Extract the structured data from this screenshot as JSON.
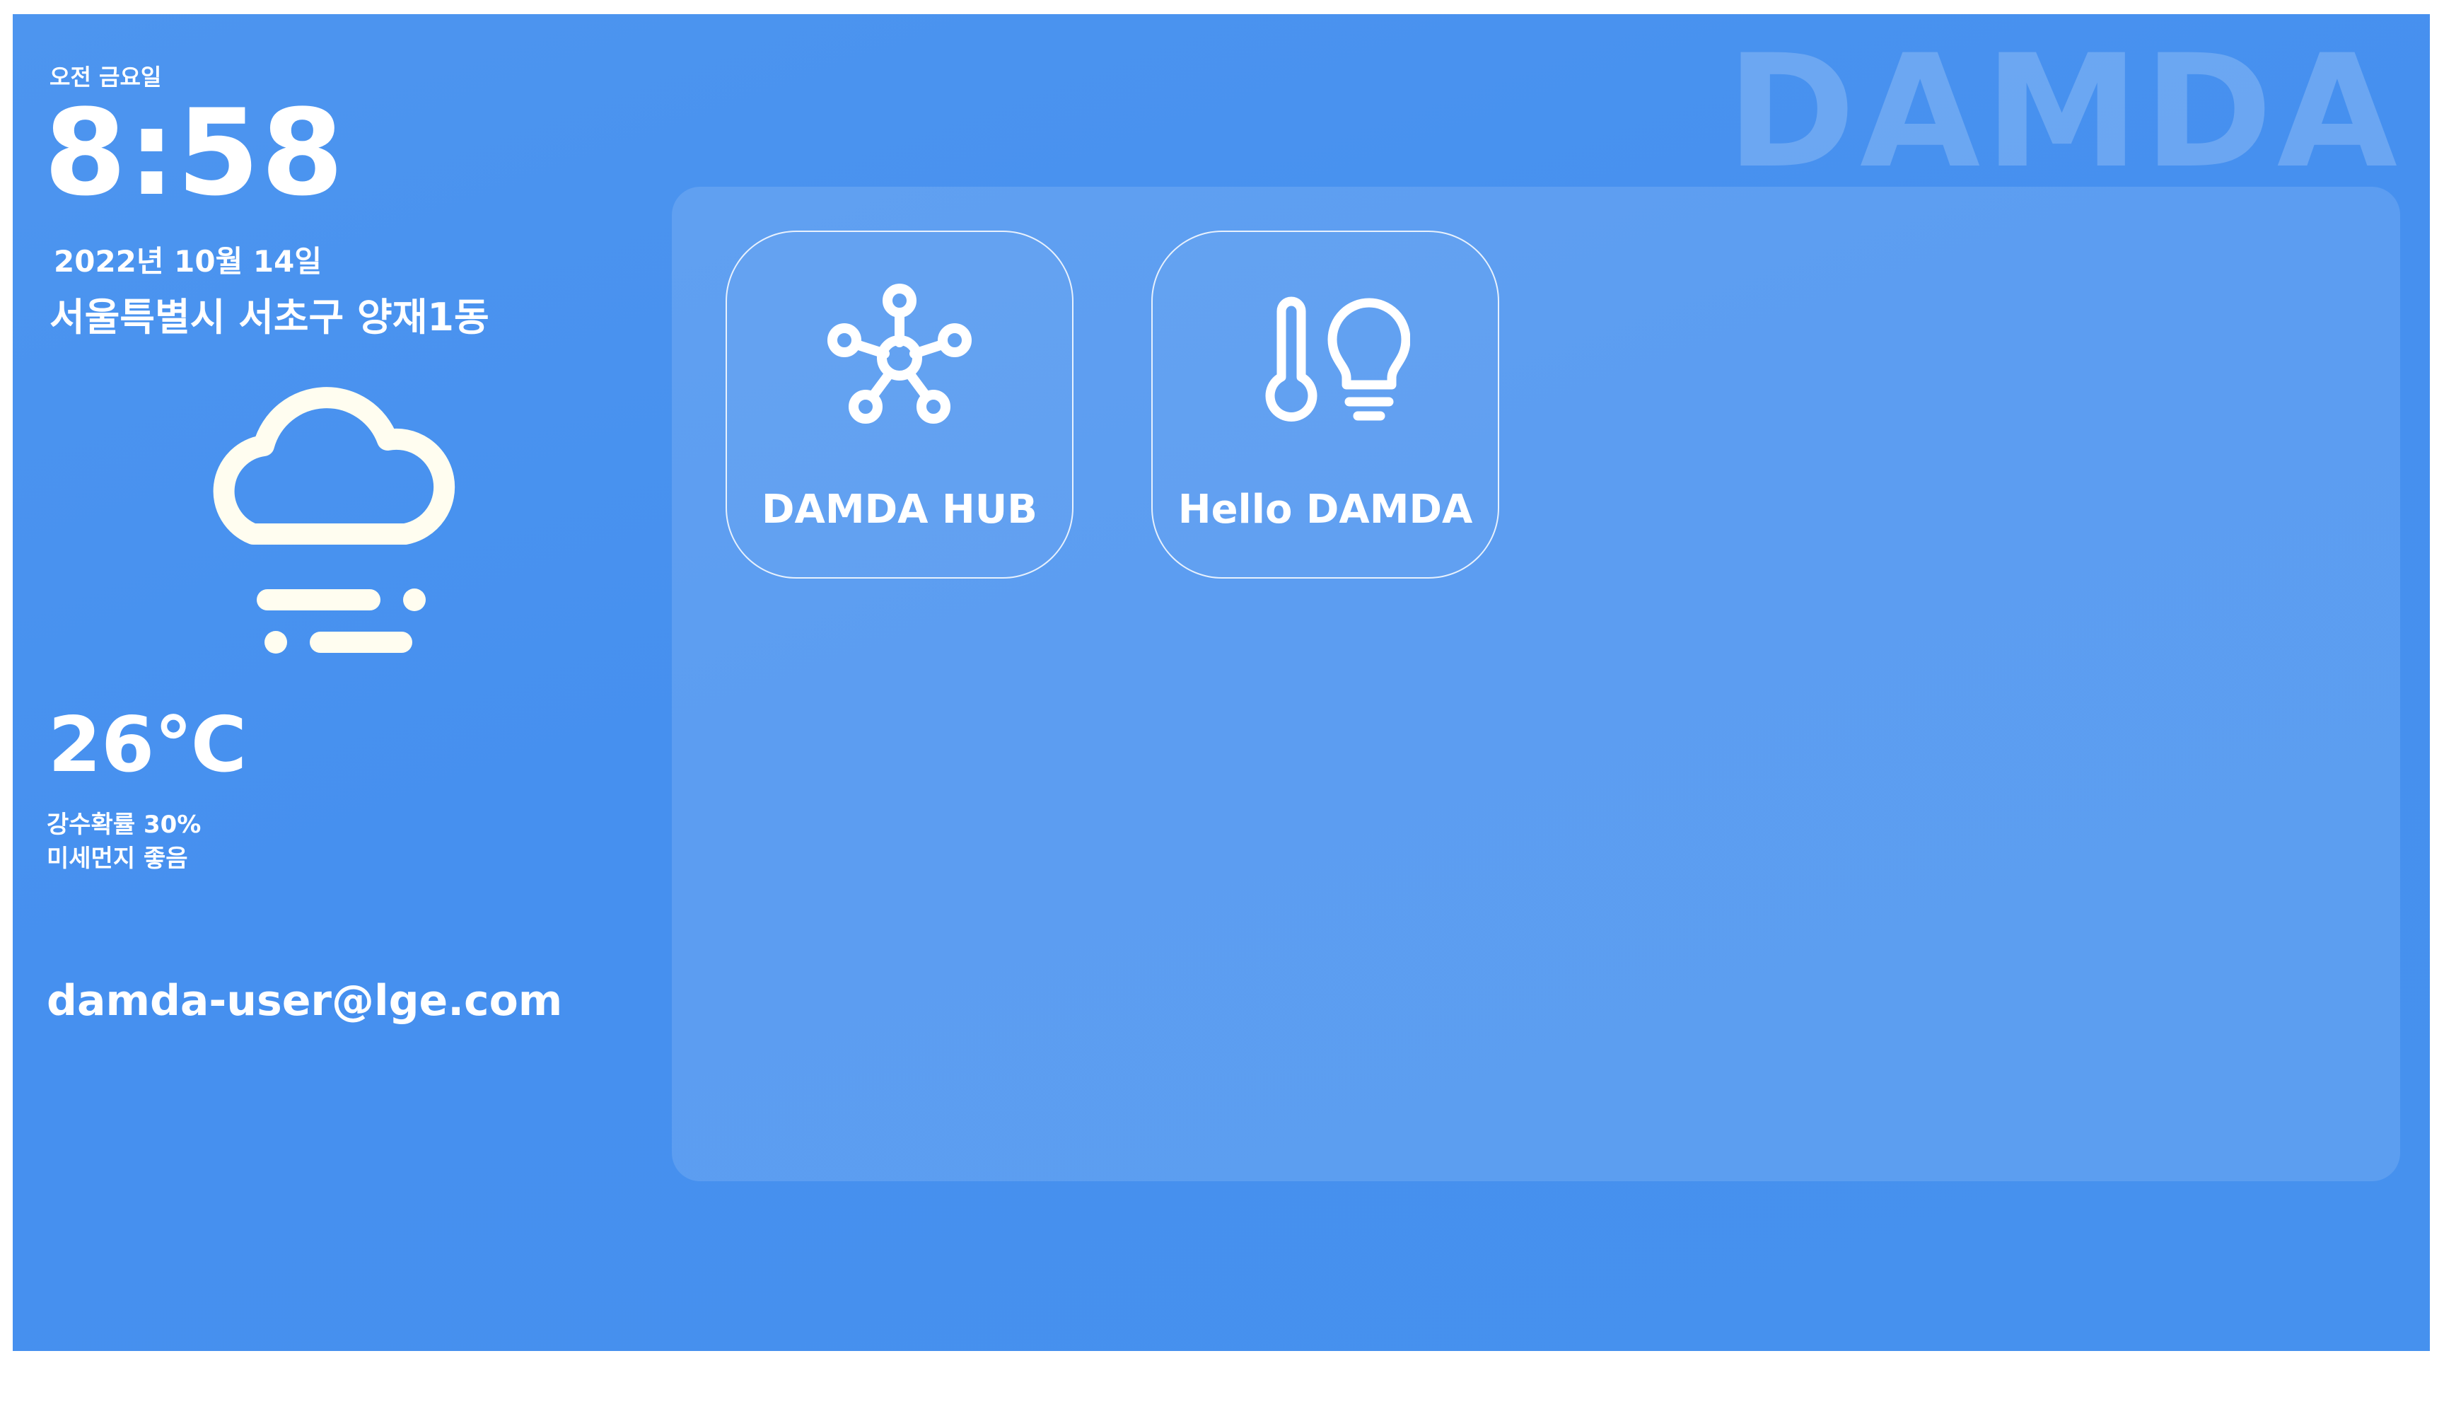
{
  "brand": "DAMDA",
  "clock": {
    "day_label": "오전 금요일",
    "time": "8:58",
    "date": "2022년 10월 14일"
  },
  "location": "서울특별시 서초구 양재1동",
  "weather": {
    "icon": "cloud-fog-icon",
    "temperature": "26℃",
    "precipitation": "강수확률 30%",
    "fine_dust": "미세먼지 좋음"
  },
  "user": {
    "email": "damda-user@lge.com"
  },
  "apps": [
    {
      "label": "DAMDA HUB",
      "icon": "hub-network-icon"
    },
    {
      "label": "Hello DAMDA",
      "icon": "thermometer-bulb-icon"
    }
  ],
  "colors": {
    "background": "#4690ef",
    "panel": "rgba(255,255,255,0.12)",
    "text": "#ffffff",
    "weather_icon": "#fffdf0"
  }
}
